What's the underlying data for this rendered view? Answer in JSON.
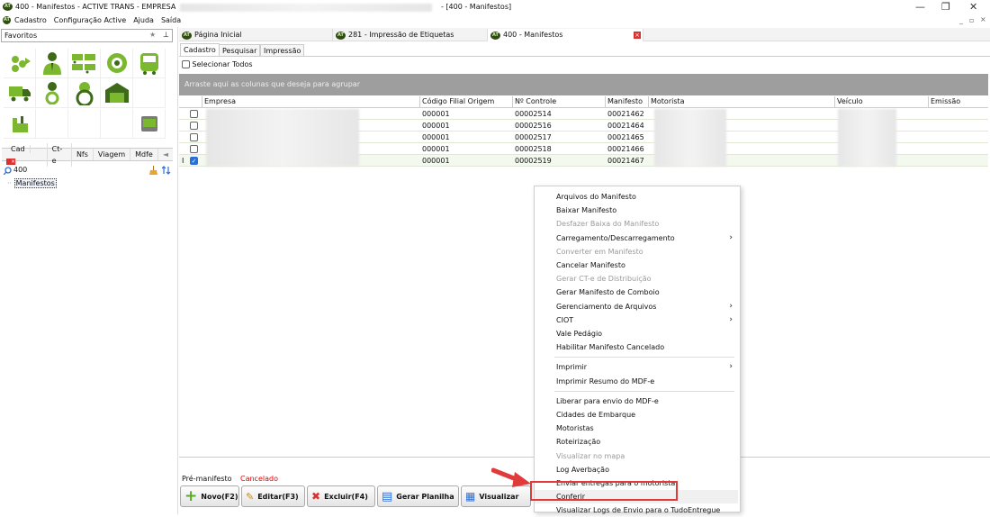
{
  "window": {
    "title": "400 - Manifestos - ACTIVE TRANS - EMPRESA",
    "title_right": "- [400 - Manifestos]",
    "logo_text": "AT"
  },
  "menu": [
    "Cadastro",
    "Configuração Active",
    "Ajuda",
    "Saída"
  ],
  "window_controls": {
    "minimize": "—",
    "restore": "❐",
    "close": "✕"
  },
  "mdi_controls": {
    "minimize": "_",
    "restore": "▫",
    "close": "×"
  },
  "favorites": {
    "label": "Favoritos",
    "star": "★",
    "pin": "⊥"
  },
  "left_tabs": [
    "Cad",
    "Ct-e",
    "Nfs",
    "Viagem",
    "Mdfe"
  ],
  "left_tabs_arrow": "◄",
  "left_close": "×",
  "search": {
    "value": "400"
  },
  "tree": {
    "item": "Manifestos"
  },
  "doc_tabs": [
    {
      "label": "Página Inicial"
    },
    {
      "label": "281 - Impressão de Etiquetas"
    },
    {
      "label": "400 - Manifestos"
    }
  ],
  "doc_tab_close": "×",
  "sub_tabs": [
    "Cadastro",
    "Pesquisar",
    "Impressão"
  ],
  "select_all": "Selecionar Todos",
  "group_hint": "Arraste aqui as colunas que deseja para agrupar",
  "columns": [
    "Empresa",
    "Código Filial Origem",
    "Nº Controle",
    "Manifesto",
    "Motorista",
    "Veículo",
    "Emissão"
  ],
  "rows": [
    {
      "filial": "000001",
      "controle": "00002514",
      "manifesto": "00021462",
      "checked": false
    },
    {
      "filial": "000001",
      "controle": "00002516",
      "manifesto": "00021464",
      "checked": false
    },
    {
      "filial": "000001",
      "controle": "00002517",
      "manifesto": "00021465",
      "checked": false
    },
    {
      "filial": "000001",
      "controle": "00002518",
      "manifesto": "00021466",
      "checked": false
    },
    {
      "filial": "000001",
      "controle": "00002519",
      "manifesto": "00021467",
      "checked": true
    }
  ],
  "row_indicator": "I",
  "check_mark": "✓",
  "legend": {
    "pre": "Pré-manifesto",
    "cancel": "Cancelado"
  },
  "buttons": [
    {
      "label": "Novo(F2)",
      "icon": "+"
    },
    {
      "label": "Editar(F3)",
      "icon": "✎"
    },
    {
      "label": "Excluir(F4)",
      "icon": "✖"
    },
    {
      "label": "Gerar Planilha",
      "icon": "▤"
    },
    {
      "label": "Visualizar",
      "icon": "▦"
    }
  ],
  "context_menu": [
    {
      "label": "Arquivos do Manifesto",
      "disabled": false
    },
    {
      "label": "Baixar Manifesto",
      "disabled": false
    },
    {
      "label": "Desfazer Baixa do Manifesto",
      "disabled": true
    },
    {
      "label": "Carregamento/Descarregamento",
      "disabled": false,
      "submenu": true
    },
    {
      "label": "Converter em Manifesto",
      "disabled": true
    },
    {
      "label": "Cancelar Manifesto",
      "disabled": false
    },
    {
      "label": "Gerar CT-e de Distribuição",
      "disabled": true
    },
    {
      "label": "Gerar Manifesto de Comboio",
      "disabled": false
    },
    {
      "label": "Gerenciamento de Arquivos",
      "disabled": false,
      "submenu": true
    },
    {
      "label": "CIOT",
      "disabled": false,
      "submenu": true
    },
    {
      "label": "Vale Pedágio",
      "disabled": false
    },
    {
      "label": "Habilitar Manifesto Cancelado",
      "disabled": false
    },
    {
      "label": "Imprimir",
      "disabled": false,
      "submenu": true
    },
    {
      "label": "Imprimir Resumo do MDF-e",
      "disabled": false
    },
    {
      "label": "Liberar para envio do MDF-e",
      "disabled": false
    },
    {
      "label": "Cidades de Embarque",
      "disabled": false
    },
    {
      "label": "Motoristas",
      "disabled": false
    },
    {
      "label": "Roteirização",
      "disabled": false
    },
    {
      "label": "Visualizar no mapa",
      "disabled": true
    },
    {
      "label": "Log Averbação",
      "disabled": false
    },
    {
      "label": "Enviar entregas para o motorista",
      "disabled": false
    },
    {
      "label": "Conferir",
      "disabled": false,
      "highlighted": true
    },
    {
      "label": "Visualizar Logs de Envio para o TudoEntregue",
      "disabled": false
    }
  ],
  "submenu_arrow": "›",
  "colors": {
    "accent_green": "#7cb82f",
    "highlight_red": "#e03a3a",
    "group_bar": "#9e9e9e",
    "cancel_text": "#e00000"
  }
}
